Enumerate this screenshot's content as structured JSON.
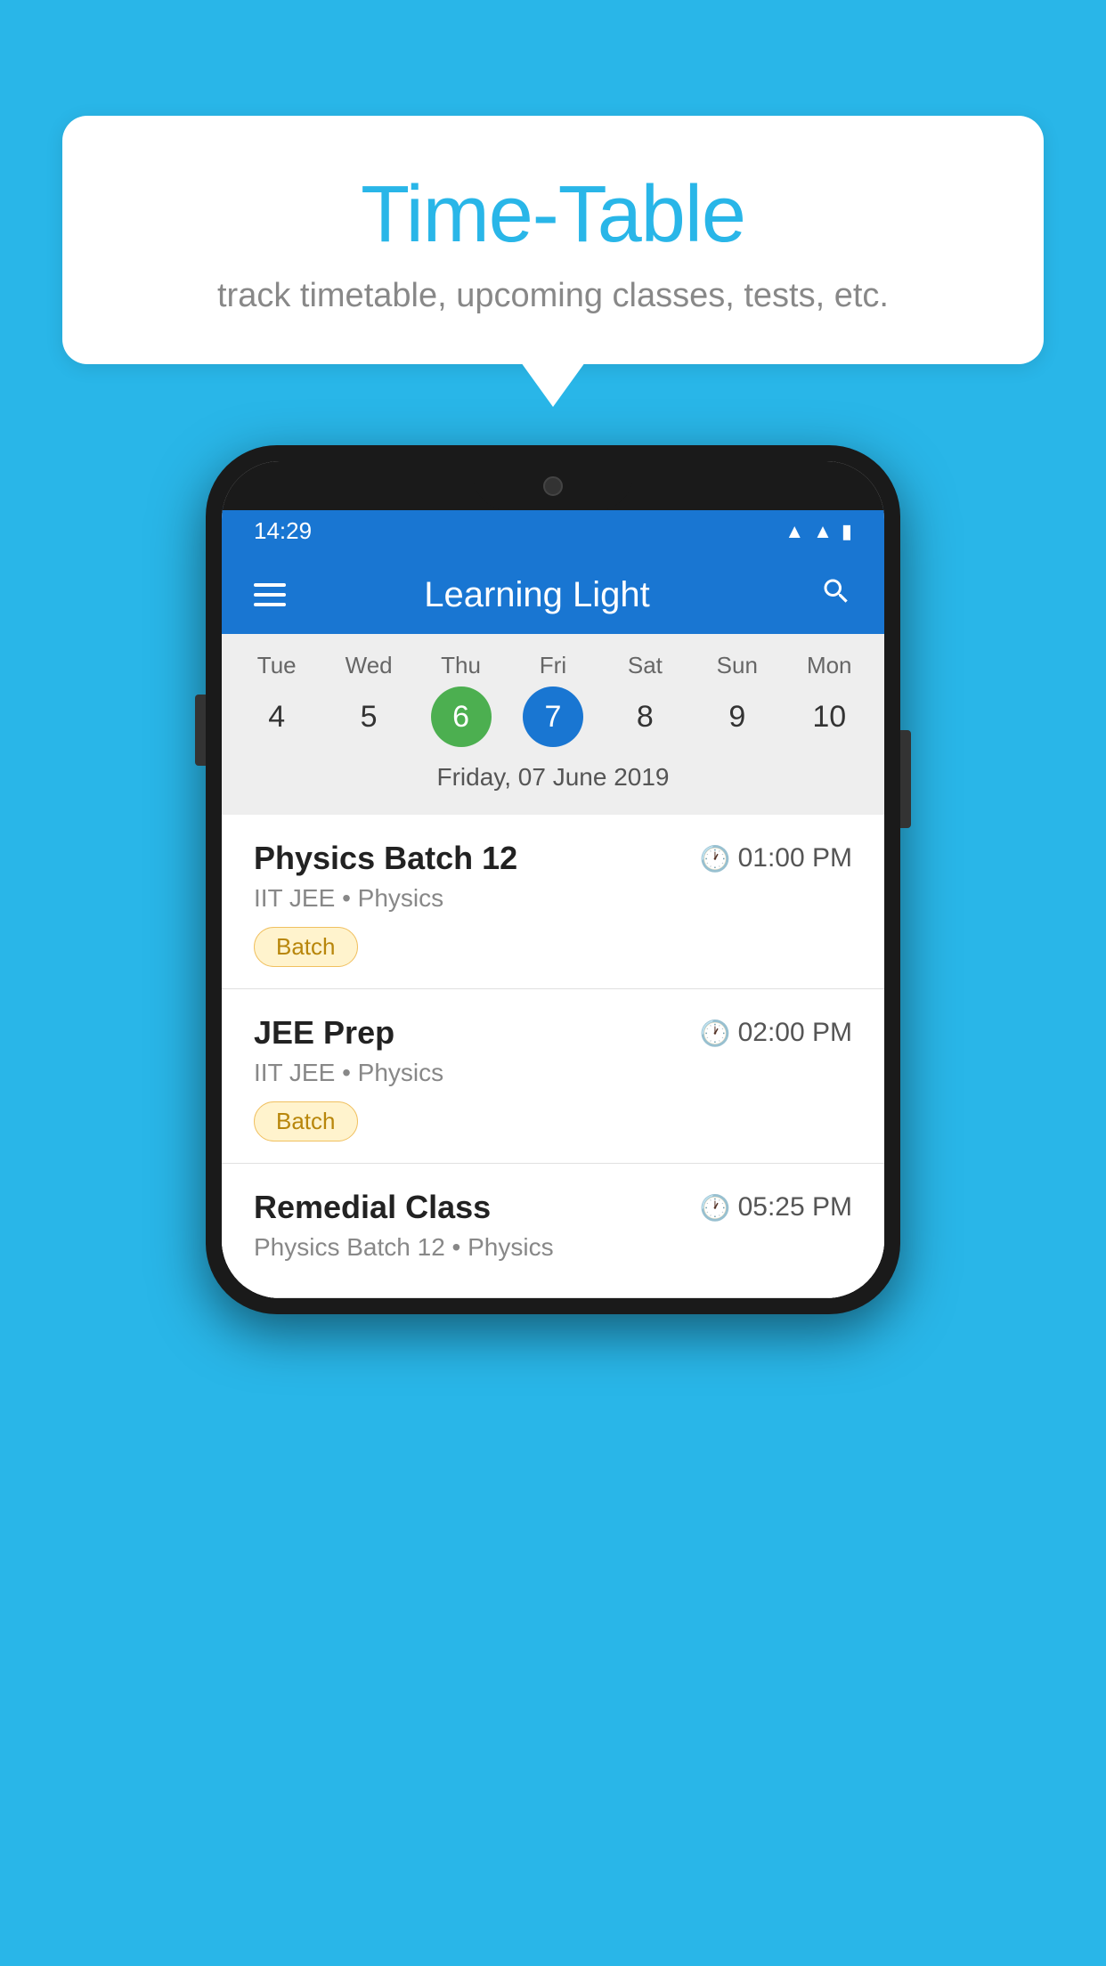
{
  "background_color": "#29b6e8",
  "speech_bubble": {
    "title": "Time-Table",
    "subtitle": "track timetable, upcoming classes, tests, etc."
  },
  "phone": {
    "status_bar": {
      "time": "14:29",
      "icons": [
        "wifi",
        "signal",
        "battery"
      ]
    },
    "app_bar": {
      "title": "Learning Light",
      "menu_icon": "hamburger-icon",
      "search_icon": "search-icon"
    },
    "calendar": {
      "days": [
        {
          "label": "Tue",
          "number": "4"
        },
        {
          "label": "Wed",
          "number": "5"
        },
        {
          "label": "Thu",
          "number": "6",
          "state": "today"
        },
        {
          "label": "Fri",
          "number": "7",
          "state": "selected"
        },
        {
          "label": "Sat",
          "number": "8"
        },
        {
          "label": "Sun",
          "number": "9"
        },
        {
          "label": "Mon",
          "number": "10"
        }
      ],
      "selected_date_label": "Friday, 07 June 2019"
    },
    "classes": [
      {
        "title": "Physics Batch 12",
        "time": "01:00 PM",
        "subtitle": "IIT JEE • Physics",
        "badge": "Batch"
      },
      {
        "title": "JEE Prep",
        "time": "02:00 PM",
        "subtitle": "IIT JEE • Physics",
        "badge": "Batch"
      },
      {
        "title": "Remedial Class",
        "time": "05:25 PM",
        "subtitle": "Physics Batch 12 • Physics",
        "badge": ""
      }
    ]
  }
}
